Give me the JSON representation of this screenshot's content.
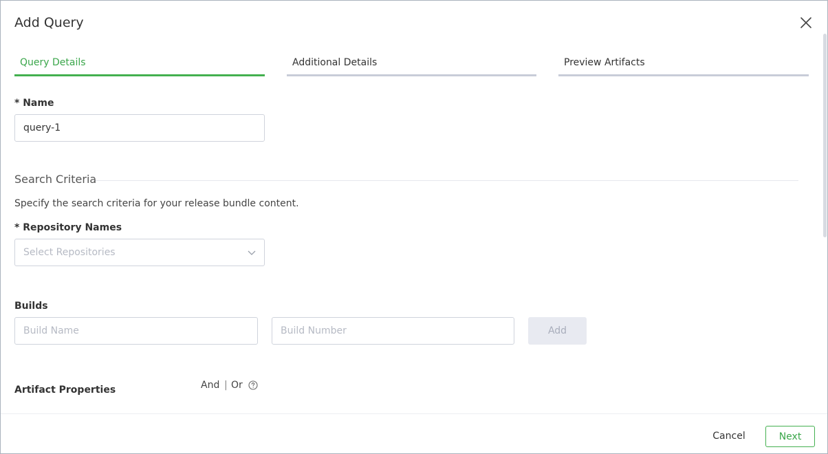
{
  "dialog": {
    "title": "Add Query"
  },
  "tabs": [
    {
      "label": "Query Details",
      "active": true
    },
    {
      "label": "Additional Details",
      "active": false
    },
    {
      "label": "Preview Artifacts",
      "active": false
    }
  ],
  "name_field": {
    "label": "* Name",
    "value": "query-1"
  },
  "search_criteria": {
    "title": "Search Criteria",
    "hint": "Specify the search criteria for your release bundle content."
  },
  "repositories": {
    "label": "* Repository Names",
    "placeholder": "Select Repositories"
  },
  "builds": {
    "label": "Builds",
    "build_name_placeholder": "Build Name",
    "build_number_placeholder": "Build Number",
    "add_label": "Add"
  },
  "artifact_properties": {
    "label": "Artifact Properties",
    "and_label": "And",
    "separator": "|",
    "or_label": "Or",
    "help_icon": "question-circle-icon"
  },
  "footer": {
    "cancel_label": "Cancel",
    "next_label": "Next"
  },
  "colors": {
    "accent": "#43b04f",
    "tab_inactive_bar": "#c8ccd8",
    "border": "#cfd3dc"
  },
  "icons": {
    "close": "close-icon",
    "dropdown": "chevron-down-icon"
  }
}
